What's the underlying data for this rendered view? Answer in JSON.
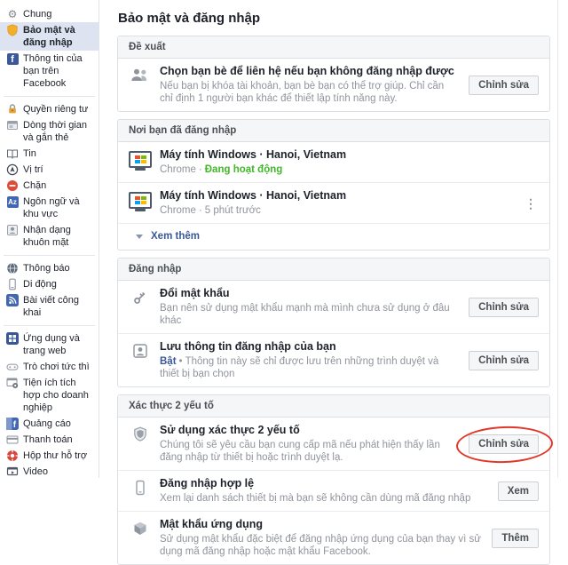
{
  "page": {
    "title": "Bảo mật và đăng nhập"
  },
  "colors": {
    "link_blue": "#385898",
    "active_green": "#42b72a",
    "annotation_red": "#e2372b",
    "facebook_blue": "#3b5998",
    "selected_nav_bg": "#dde3f0"
  },
  "sidebar": {
    "groups": [
      {
        "items": [
          {
            "icon": "gear-icon",
            "label": "Chung"
          },
          {
            "icon": "security-shield-icon",
            "label": "Bảo mật và đăng nhập",
            "selected": true
          },
          {
            "icon": "facebook-icon",
            "label": "Thông tin của bạn trên Facebook"
          }
        ]
      },
      {
        "items": [
          {
            "icon": "lock-icon",
            "label": "Quyền riêng tư"
          },
          {
            "icon": "timeline-icon",
            "label": "Dòng thời gian và gắn thẻ"
          },
          {
            "icon": "news-icon",
            "label": "Tin"
          },
          {
            "icon": "location-icon",
            "label": "Vị trí"
          },
          {
            "icon": "block-icon",
            "label": "Chặn"
          },
          {
            "icon": "language-icon",
            "label": "Ngôn ngữ và khu vực"
          },
          {
            "icon": "face-recognition-icon",
            "label": "Nhận dạng khuôn mặt"
          }
        ]
      },
      {
        "items": [
          {
            "icon": "globe-icon",
            "label": "Thông báo"
          },
          {
            "icon": "mobile-icon",
            "label": "Di động"
          },
          {
            "icon": "rss-icon",
            "label": "Bài viết công khai"
          }
        ]
      },
      {
        "items": [
          {
            "icon": "apps-icon",
            "label": "Ứng dụng và trang web"
          },
          {
            "icon": "game-icon",
            "label": "Trò chơi tức thì"
          },
          {
            "icon": "business-icon",
            "label": "Tiện ích tích hợp cho doanh nghiệp"
          },
          {
            "icon": "ads-icon",
            "label": "Quảng cáo"
          },
          {
            "icon": "payments-icon",
            "label": "Thanh toán"
          },
          {
            "icon": "support-icon",
            "label": "Hộp thư hỗ trợ"
          },
          {
            "icon": "video-icon",
            "label": "Video"
          }
        ]
      }
    ]
  },
  "sections": {
    "recommended": {
      "header": "Đề xuất",
      "trusted_contacts": {
        "title": "Chọn bạn bè để liên hệ nếu bạn không đăng nhập được",
        "description": "Nếu bạn bị khóa tài khoản, bạn bè bạn có thể trợ giúp. Chỉ cần chỉ định 1 người bạn khác để thiết lập tính năng này.",
        "button": "Chỉnh sửa"
      }
    },
    "where_logged_in": {
      "header": "Nơi bạn đã đăng nhập",
      "sessions": [
        {
          "device": "Máy tính Windows · Hanoi, Vietnam",
          "browser": "Chrome",
          "separator": "·",
          "status": "Đang hoạt động",
          "active": true
        },
        {
          "device": "Máy tính Windows · Hanoi, Vietnam",
          "browser": "Chrome",
          "separator": "·",
          "status": "5 phút trước",
          "active": false
        }
      ],
      "see_more": "Xem thêm"
    },
    "login": {
      "header": "Đăng nhập",
      "change_password": {
        "title": "Đổi mật khẩu",
        "description": "Bạn nên sử dụng mật khẩu mạnh mà mình chưa sử dụng ở đâu khác",
        "button": "Chỉnh sửa"
      },
      "save_login": {
        "title": "Lưu thông tin đăng nhập của bạn",
        "status": "Bật",
        "separator": "•",
        "description": "Thông tin này sẽ chỉ được lưu trên những trình duyệt và thiết bị bạn chọn",
        "button": "Chỉnh sửa"
      }
    },
    "two_factor": {
      "header": "Xác thực 2 yếu tố",
      "use_two_factor": {
        "title": "Sử dụng xác thực 2 yếu tố",
        "description": "Chúng tôi sẽ yêu cầu bạn cung cấp mã nếu phát hiện thấy lần đăng nhập từ thiết bị hoặc trình duyệt lạ.",
        "button": "Chỉnh sửa",
        "highlighted": true
      },
      "authorized_logins": {
        "title": "Đăng nhập hợp lệ",
        "description": "Xem lại danh sách thiết bị mà bạn sẽ không cần dùng mã đăng nhập",
        "button": "Xem"
      },
      "app_passwords": {
        "title": "Mật khẩu ứng dụng",
        "description": "Sử dụng mật khẩu đặc biệt để đăng nhập ứng dụng của bạn thay vì sử dụng mã đăng nhập hoặc mật khẩu Facebook.",
        "button": "Thêm"
      }
    }
  },
  "annotation": {
    "type": "ellipse-highlight",
    "color": "#e2372b",
    "target": "two-factor-edit-button"
  }
}
